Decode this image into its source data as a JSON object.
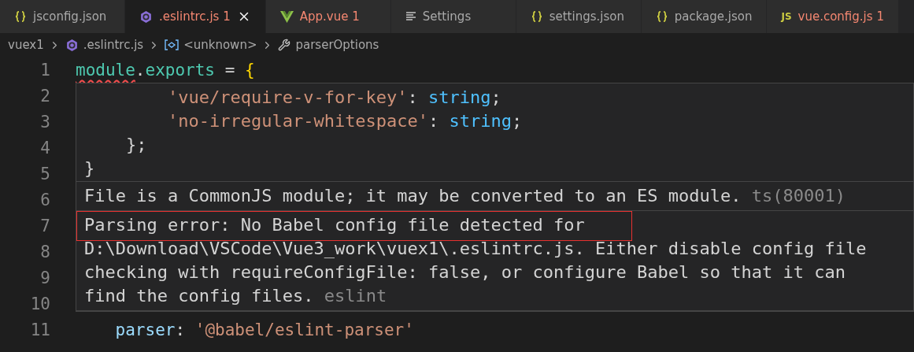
{
  "tabs": [
    {
      "label": "jsconfig.json",
      "kind": "json",
      "error": false,
      "selected": false
    },
    {
      "label": ".eslintrc.js",
      "kind": "eslint",
      "badge": "1",
      "error": true,
      "selected": true
    },
    {
      "label": "App.vue",
      "kind": "vue",
      "badge": "1",
      "error": true,
      "selected": false
    },
    {
      "label": "Settings",
      "kind": "settings",
      "error": false,
      "selected": false
    },
    {
      "label": "settings.json",
      "kind": "json",
      "error": false,
      "selected": false
    },
    {
      "label": "package.json",
      "kind": "json",
      "error": false,
      "selected": false
    },
    {
      "label": "vue.config.js",
      "kind": "js",
      "icon_text": "JS",
      "badge": "1",
      "error": true,
      "selected": false
    }
  ],
  "breadcrumb": [
    {
      "label": "vuex1",
      "kind": "folder"
    },
    {
      "label": ".eslintrc.js",
      "kind": "file"
    },
    {
      "label": "<unknown>",
      "kind": "variable"
    },
    {
      "label": "parserOptions",
      "kind": "property"
    }
  ],
  "editor": {
    "lines": [
      {
        "number": "1",
        "tokens": [
          {
            "text": "module",
            "kind": "variable",
            "error": true
          },
          {
            "text": ".",
            "kind": "plain"
          },
          {
            "text": "exports",
            "kind": "variable"
          },
          {
            "text": " = ",
            "kind": "plain"
          },
          {
            "text": "{",
            "kind": "bracket"
          }
        ]
      },
      {
        "number": "2"
      },
      {
        "number": "3"
      },
      {
        "number": "4"
      },
      {
        "number": "5"
      },
      {
        "number": "6"
      },
      {
        "number": "7"
      },
      {
        "number": "8"
      },
      {
        "number": "9"
      },
      {
        "number": "10"
      },
      {
        "number": "11",
        "tokens": [
          {
            "text": "    parser",
            "kind": "property"
          },
          {
            "text": ": ",
            "kind": "plain"
          },
          {
            "text": "'@babel/eslint-parser'",
            "kind": "string"
          }
        ]
      }
    ]
  },
  "hover": {
    "code": [
      [
        {
          "text": "        'vue/require-v-for-key'",
          "kind": "string"
        },
        {
          "text": ": ",
          "kind": "plain"
        },
        {
          "text": "string",
          "kind": "type"
        },
        {
          "text": ";",
          "kind": "plain"
        }
      ],
      [
        {
          "text": "        'no-irregular-whitespace'",
          "kind": "string"
        },
        {
          "text": ": ",
          "kind": "plain"
        },
        {
          "text": "string",
          "kind": "type"
        },
        {
          "text": ";",
          "kind": "plain"
        }
      ],
      [
        {
          "text": "    };",
          "kind": "plain"
        }
      ],
      [
        {
          "text": "}",
          "kind": "plain"
        }
      ]
    ],
    "messages": [
      {
        "text": "File is a CommonJS module; it may be converted to an ES module.",
        "source": "ts(80001)",
        "marked": false
      },
      {
        "text": "Parsing error: No Babel config file detected for D:\\Download\\VSCode\\Vue3_work\\vuex1\\.eslintrc.js. Either disable config file checking with requireConfigFile: false, or configure Babel so that it can find the config files.",
        "source": "eslint",
        "marked": true
      }
    ]
  }
}
